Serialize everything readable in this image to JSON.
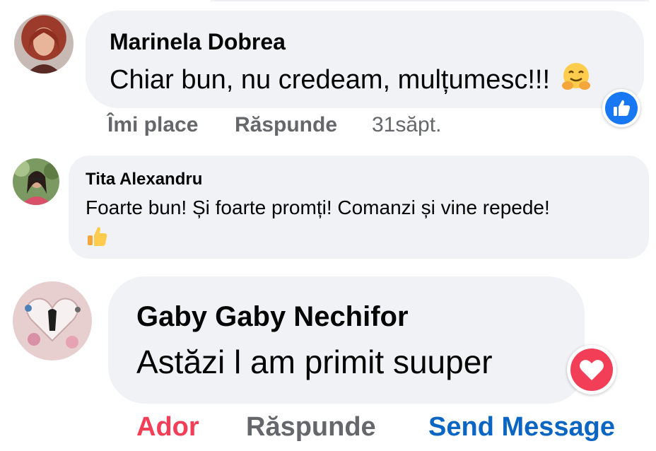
{
  "comments": [
    {
      "author": "Marinela Dobrea",
      "text": "Chiar bun, nu credeam, mulțumesc!!!",
      "emoji": "hugging-face",
      "reaction": "like",
      "actions": {
        "like": "Îmi place",
        "reply": "Răspunde",
        "time": "31săpt."
      }
    },
    {
      "author": "Tita Alexandru",
      "text": "Foarte bun! Și foarte promți! Comanzi și vine repede!",
      "emoji": "thumbs-up"
    },
    {
      "author": "Gaby Gaby Nechifor",
      "text": "Astăzi l am primit suuper",
      "reaction": "love",
      "actions": {
        "like": "Ador",
        "reply": "Răspunde",
        "message": "Send Message"
      }
    }
  ],
  "colors": {
    "bubble": "#f0f2f5",
    "action_gray": "#65676b",
    "like_blue": "#1877f2",
    "love_red": "#f33e58",
    "send_blue": "#0a66c2"
  }
}
